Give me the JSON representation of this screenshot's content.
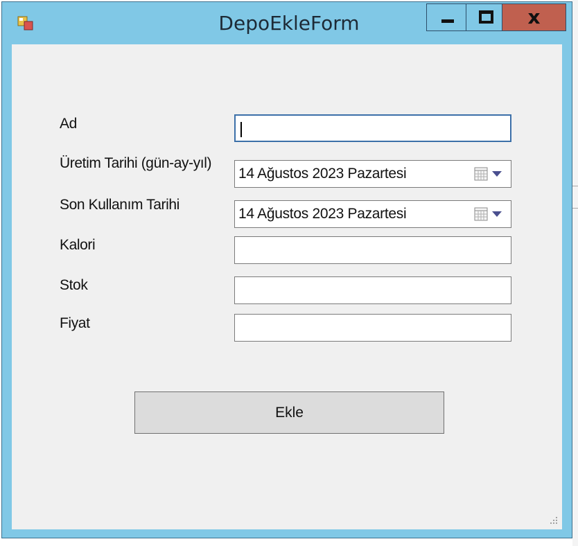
{
  "window": {
    "title": "DepoEkleForm",
    "close_glyph": "x",
    "app_icon": "form-app-icon"
  },
  "form": {
    "ad": {
      "label": "Ad",
      "value": ""
    },
    "uretim_tarihi": {
      "label": "Üretim Tarihi (gün-ay-yıl)",
      "value": "14 Ağustos 2023  Pazartesi"
    },
    "son_kullanim_tarihi": {
      "label": "Son Kullanım Tarihi",
      "value": "14 Ağustos 2023  Pazartesi"
    },
    "kalori": {
      "label": "Kalori",
      "value": ""
    },
    "stok": {
      "label": "Stok",
      "value": ""
    },
    "fiyat": {
      "label": "Fiyat",
      "value": ""
    },
    "submit_label": "Ekle"
  },
  "colors": {
    "titlebar": "#80c8e6",
    "close_button": "#c0604f",
    "client_bg": "#f0f0f0",
    "focus_border": "#3b6fa8"
  }
}
